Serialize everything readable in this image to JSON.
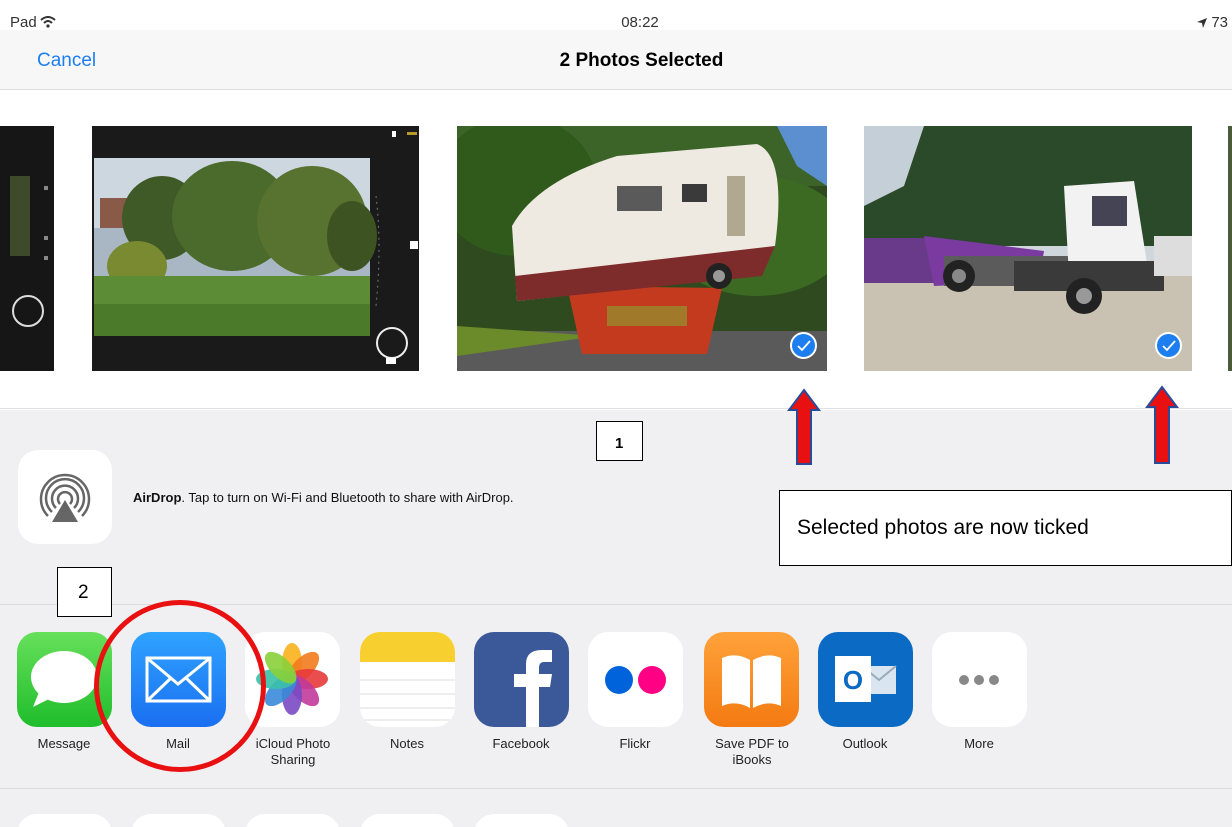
{
  "status_bar": {
    "left": "Pad",
    "time": "08:22",
    "right": "73"
  },
  "nav": {
    "cancel_label": "Cancel",
    "title": "2 Photos Selected"
  },
  "airdrop": {
    "bold": "AirDrop",
    "text": ". Tap to turn on Wi-Fi and Bluetooth to share with AirDrop."
  },
  "apps": [
    {
      "label": "Message"
    },
    {
      "label": "Mail"
    },
    {
      "label": "iCloud Photo Sharing"
    },
    {
      "label": "Notes"
    },
    {
      "label": "Facebook"
    },
    {
      "label": "Flickr"
    },
    {
      "label": "Save PDF to iBooks"
    },
    {
      "label": "Outlook"
    },
    {
      "label": "More"
    }
  ],
  "annotations": {
    "step1": "1",
    "step2": "2",
    "note": "Selected photos are now ticked"
  },
  "colors": {
    "accent": "#1d7ef0",
    "annotation_red": "#e81010"
  }
}
